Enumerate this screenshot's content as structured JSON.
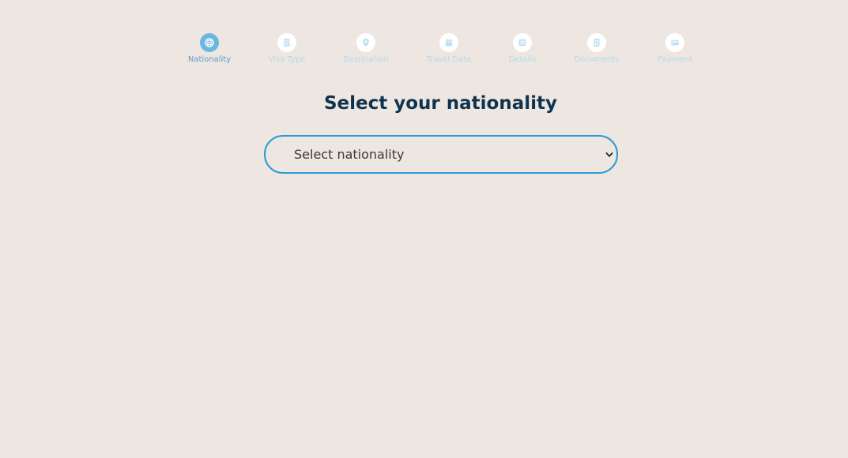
{
  "stepper": {
    "active_index": 0,
    "steps": [
      {
        "label": "Nationality",
        "icon": "globe-icon"
      },
      {
        "label": "Visa Type",
        "icon": "passport-icon"
      },
      {
        "label": "Destination",
        "icon": "map-pin-icon"
      },
      {
        "label": "Travel Date",
        "icon": "calendar-icon"
      },
      {
        "label": "Details",
        "icon": "list-icon"
      },
      {
        "label": "Documents",
        "icon": "passport-icon"
      },
      {
        "label": "Payment",
        "icon": "credit-card-icon"
      }
    ]
  },
  "main": {
    "title": "Select your nationality",
    "nationality_select": {
      "value": "Select nationality",
      "icon": "chevron-down-icon"
    }
  },
  "colors": {
    "background": "#ede6e1",
    "active_step": "#6bb7e2",
    "inactive_step_label": "#b4daef",
    "title": "#0e3350",
    "select_border": "#2a9ad6"
  }
}
